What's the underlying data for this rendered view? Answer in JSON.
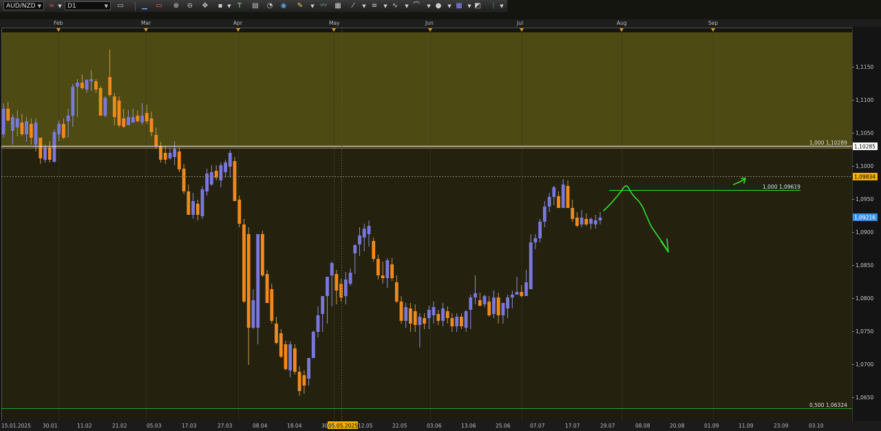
{
  "toolbar": {
    "symbol": "AUD/NZD",
    "link": "∞",
    "timeframe": "D1",
    "icons": [
      "chart-type-icon",
      "line-tool-icon",
      "remove-lines-icon",
      "zoom-in-icon",
      "zoom-out-icon",
      "pan-icon",
      "crosshair-icon",
      "text-tool-icon",
      "note-icon",
      "pie-icon",
      "globe-icon",
      "pencil-icon",
      "indicator-icon",
      "table-icon",
      "fibonacci-icon",
      "channel-icon",
      "wave-icon",
      "shape-icon",
      "circle-icon",
      "grid-icon",
      "eraser-icon",
      "more-icon"
    ]
  },
  "month_labels": [
    "Feb",
    "Mar",
    "Apr",
    "May",
    "Jun",
    "Jul",
    "Aug",
    "Sep"
  ],
  "date_labels": [
    "15.01.2025",
    "30.01",
    "11.02",
    "21.02",
    "05.03",
    "17.03",
    "27.03",
    "08.04",
    "18.04",
    "30.04",
    "05.05.2025",
    "12.05",
    "22.05",
    "03.06",
    "13.06",
    "25.06",
    "07.07",
    "17.07",
    "29.07",
    "08.08",
    "20.08",
    "01.09",
    "11.09",
    "23.09",
    "03.10"
  ],
  "price_labels": [
    "1,1150",
    "1,1100",
    "1,1050",
    "1,1000",
    "1,0950",
    "1,0900",
    "1,0850",
    "1,0800",
    "1,0750",
    "1,0700",
    "1,0650"
  ],
  "current_price": "1,09216",
  "crosshair_price": "1,09834",
  "upper_line_price": "1,10285",
  "zone_upper_label": "1,000 1,10289",
  "fib_label": "1,000 1,09619",
  "bottom_label": "0,500 1,06324",
  "colors": {
    "bull": "#7a78e0",
    "bear": "#f08a1e",
    "upper_zone": "#4d4a13",
    "lower_zone": "#24220f",
    "current_price_bg": "#3b8fe0",
    "crosshair_price_bg": "#f0b400",
    "drawing": "#2fe02f",
    "bottom_line": "#24a824"
  }
}
